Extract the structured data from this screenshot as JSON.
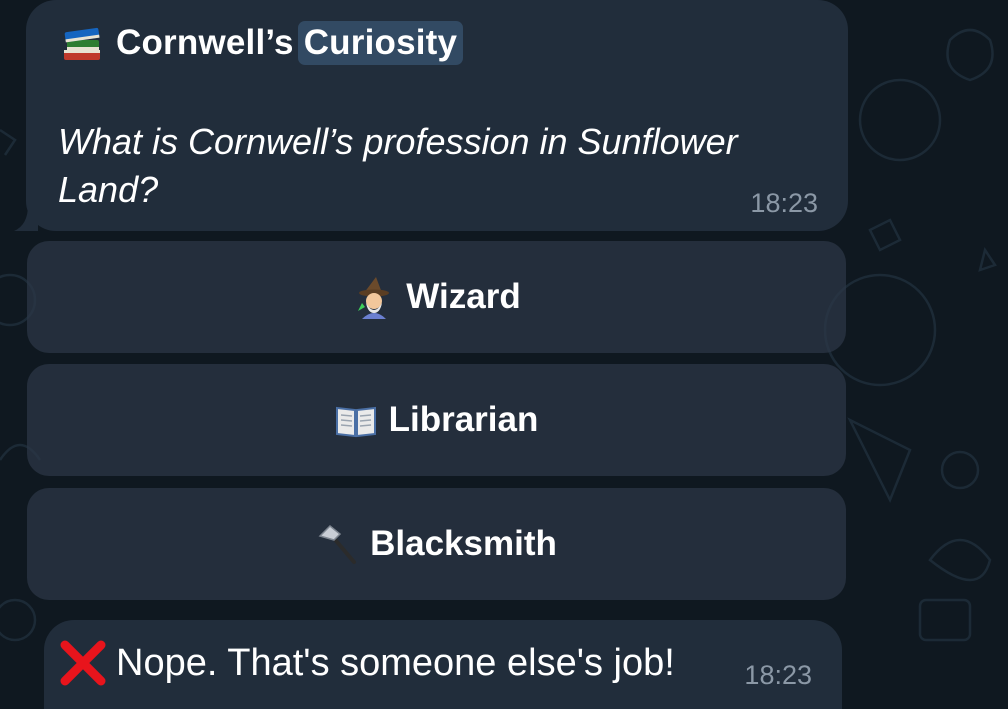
{
  "message": {
    "title_icon": "books-icon",
    "title_prefix": "Cornwell’s",
    "title_highlight": "Curiosity",
    "question": "What is Cornwell’s profession in Sunflower Land?",
    "time": "18:23"
  },
  "options": [
    {
      "icon": "wizard-emoji-icon",
      "label": "Wizard"
    },
    {
      "icon": "open-book-icon",
      "label": "Librarian"
    },
    {
      "icon": "hammer-icon",
      "label": "Blacksmith"
    }
  ],
  "reply": {
    "icon": "red-cross-icon",
    "text": "Nope. That's someone else's job!",
    "time": "18:23"
  },
  "colors": {
    "background": "#0f1820",
    "bubble": "#212d3b",
    "button": "#2c3846",
    "highlight": "#324a63",
    "timestamp": "#8b98a6",
    "cross": "#e8141c"
  }
}
